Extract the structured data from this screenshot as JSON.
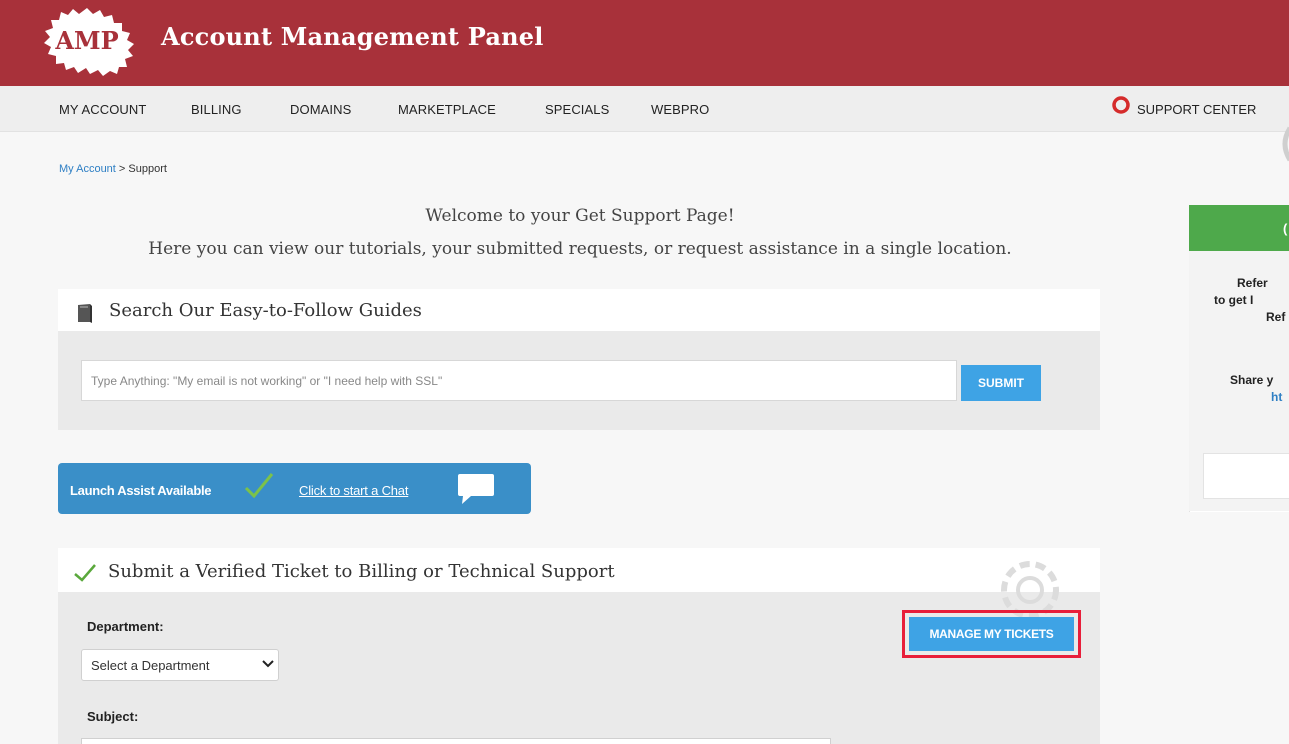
{
  "header": {
    "logo_text": "AMP",
    "title": "Account Management Panel"
  },
  "nav": {
    "items": [
      {
        "label": "MY ACCOUNT"
      },
      {
        "label": "BILLING"
      },
      {
        "label": "DOMAINS"
      },
      {
        "label": "MARKETPLACE"
      },
      {
        "label": "SPECIALS"
      },
      {
        "label": "WEBPRO"
      }
    ],
    "support_center": "SUPPORT CENTER"
  },
  "breadcrumb": {
    "link": "My Account",
    "separator": " > ",
    "current": "Support"
  },
  "welcome": {
    "line1": "Welcome to your Get Support Page!",
    "line2": "Here you can view our tutorials, your submitted requests, or request assistance in a single location."
  },
  "guides": {
    "title": "Search Our Easy-to-Follow Guides",
    "search_placeholder": "Type Anything: \"My email is not working\" or \"I need help with SSL\"",
    "search_value": "",
    "submit_label": "SUBMIT"
  },
  "chat": {
    "available_text": "Launch Assist Available",
    "link_text": "Click to start a Chat"
  },
  "ticket": {
    "title": "Submit a Verified Ticket to Billing or Technical Support",
    "department_label": "Department:",
    "department_selected": "Select a Department",
    "subject_label": "Subject:",
    "manage_label": "MANAGE MY TICKETS"
  },
  "sidebar": {
    "header_text": "(",
    "lines": [
      "Refer",
      "to get I",
      "Ref",
      "Share y"
    ],
    "link_text": "ht"
  },
  "colors": {
    "header_bg": "#a8313a",
    "accent_blue": "#3ea3e5",
    "chat_bg": "#3a8fc8",
    "highlight_red": "#e81e3a",
    "sidebar_green": "#4ea94b"
  },
  "icons": {
    "support": "lifebuoy-icon",
    "guides": "book-icon",
    "chat_status": "checkmark-icon",
    "chat": "speech-bubble-icon",
    "ticket": "checkmark-icon",
    "select": "chevron-down-icon"
  }
}
